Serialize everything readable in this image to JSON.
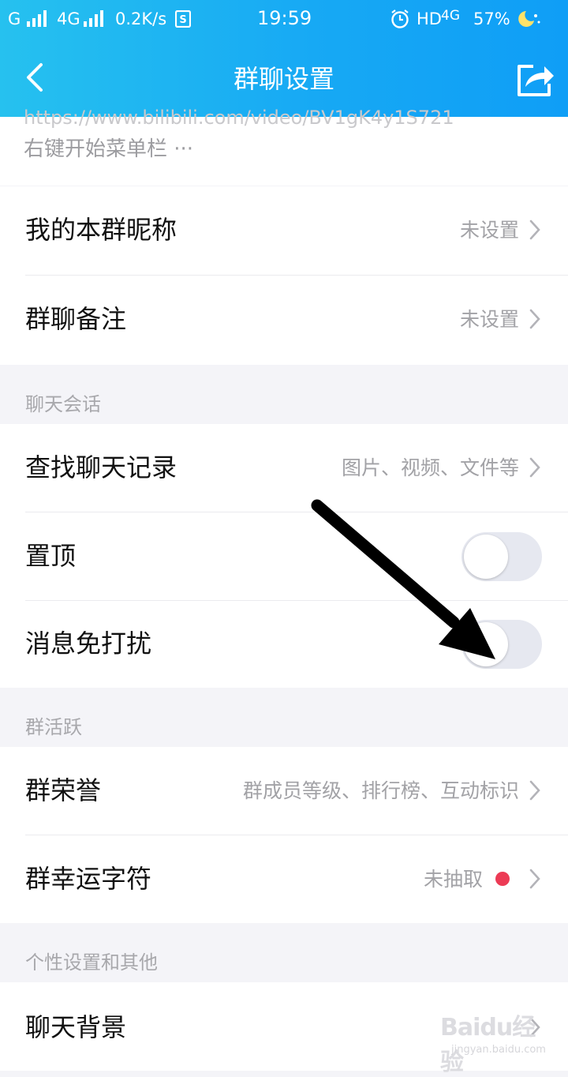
{
  "status_bar": {
    "carrier": "G",
    "network": "4G",
    "speed": "0.2K/s",
    "time": "19:59",
    "hd": "HD",
    "network2": "4G",
    "battery": "57%",
    "icons": [
      "signal-icon",
      "sim-icon",
      "alarm-icon",
      "battery-icon",
      "moon-icon"
    ]
  },
  "header": {
    "title": "群聊设置",
    "back_icon": "chevron-left-icon",
    "share_icon": "share-icon",
    "background": "#1aaef3"
  },
  "partial_item": {
    "url": "https://www.bilibili.com/video/BV1gK4y1S721",
    "text": "右键开始菜单栏 ···"
  },
  "rows_top": [
    {
      "label": "我的本群昵称",
      "value": "未设置"
    },
    {
      "label": "群聊备注",
      "value": "未设置"
    }
  ],
  "chat_session": {
    "header": "聊天会话",
    "search": {
      "label": "查找聊天记录",
      "value": "图片、视频、文件等"
    },
    "pin": {
      "label": "置顶",
      "on": false
    },
    "mute": {
      "label": "消息免打扰",
      "on": false
    }
  },
  "group_activity": {
    "header": "群活跃",
    "honor": {
      "label": "群荣誉",
      "value": "群成员等级、排行榜、互动标识"
    },
    "lucky": {
      "label": "群幸运字符",
      "value": "未抽取"
    }
  },
  "personal": {
    "header": "个性设置和其他",
    "background": {
      "label": "聊天背景"
    }
  },
  "watermark": {
    "logo": "Baidu经验",
    "url": "jingyan.baidu.com"
  },
  "colors": {
    "accent": "#1aaef3",
    "red_dot": "#ec3b55",
    "toggle_off": "#e6e8f0"
  }
}
